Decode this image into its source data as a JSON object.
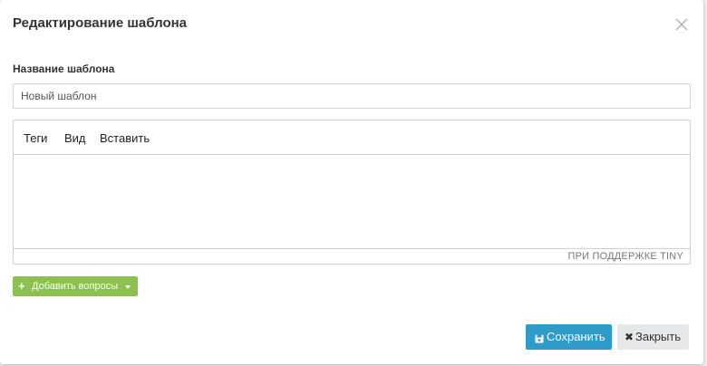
{
  "dialog": {
    "title": "Редактирование шаблона"
  },
  "form": {
    "name_label": "Название шаблона",
    "name_value": "Новый шаблон"
  },
  "editor": {
    "menu": [
      "Теги",
      "Вид",
      "Вставить"
    ],
    "content": "",
    "powered_by": "ПРИ ПОДДЕРЖКЕ TINY"
  },
  "add_questions": {
    "label": "Добавить вопросы",
    "color": "#8cc152"
  },
  "footer": {
    "save_label": "Сохранить",
    "save_color": "#2e9bc9",
    "close_label": "Закрыть",
    "close_color": "#e6e7e8"
  }
}
